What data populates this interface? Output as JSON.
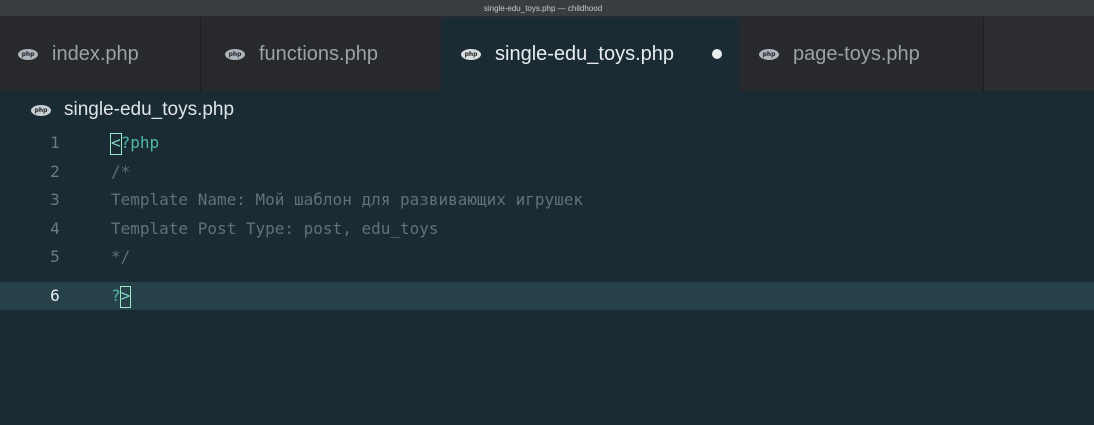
{
  "window": {
    "title": "single-edu_toys.php — childhood"
  },
  "tabs": [
    {
      "label": "index.php",
      "icon": "php-file-icon",
      "icon_text": "php",
      "active": false
    },
    {
      "label": "functions.php",
      "icon": "php-file-icon",
      "icon_text": "php",
      "active": false
    },
    {
      "label": "single-edu_toys.php",
      "icon": "php-file-icon",
      "icon_text": "php",
      "active": true,
      "modified": true
    },
    {
      "label": "page-toys.php",
      "icon": "php-file-icon",
      "icon_text": "php",
      "active": false
    }
  ],
  "breadcrumb": {
    "icon": "php-file-icon",
    "icon_text": "php",
    "label": "single-edu_toys.php"
  },
  "editor": {
    "lines": [
      {
        "number": "1",
        "text_prefix": "<",
        "text": "?php"
      },
      {
        "number": "2",
        "text": "/*"
      },
      {
        "number": "3",
        "text": "Template Name: Мой шаблон для развивающих игрушек"
      },
      {
        "number": "4",
        "text": "Template Post Type: post, edu_toys"
      },
      {
        "number": "5",
        "text": "*/"
      },
      {
        "number": "6",
        "text": "?",
        "text_suffix": ">"
      }
    ],
    "current_line": "6"
  },
  "colors": {
    "editor_bg": "#1a2b34",
    "php_tag": "#4fb6a8",
    "comment": "#5e737c",
    "current_line_bg": "#27414a"
  }
}
